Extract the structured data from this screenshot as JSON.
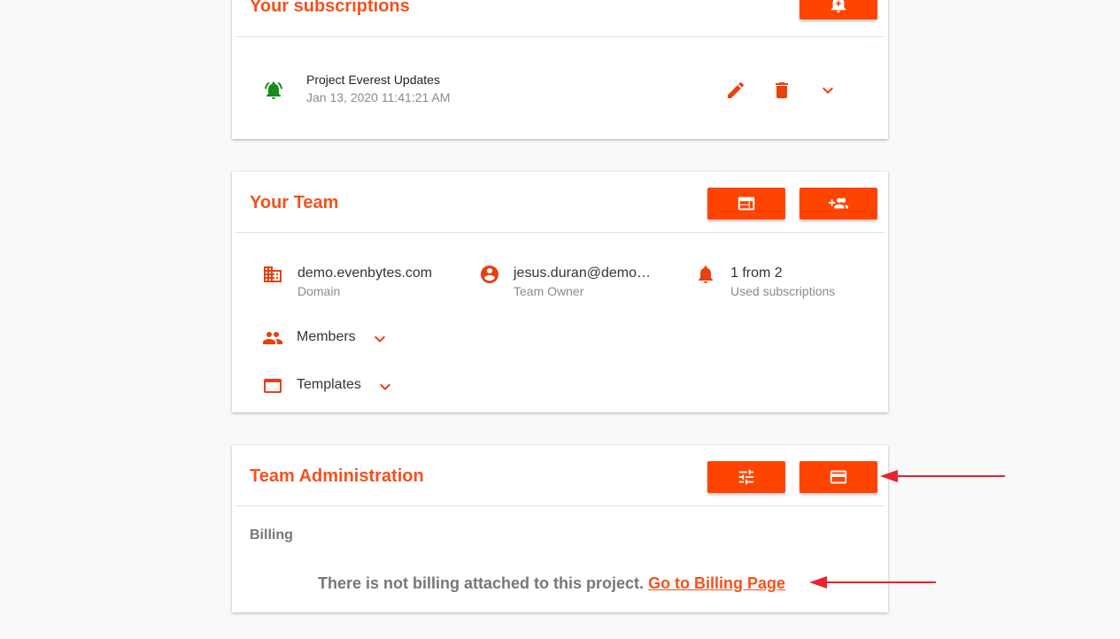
{
  "colors": {
    "accent": "#ff4400",
    "title": "#f4511e",
    "bell_active": "#1b8a1b",
    "annotation_arrow": "#e8232a"
  },
  "subscriptions": {
    "title": "Your subscriptions",
    "add_button_icon": "add-alert-icon",
    "item": {
      "name": "Project Everest Updates",
      "date": "Jan 13, 2020 11:41:21 AM",
      "icons": [
        "bell-ringing-icon",
        "edit-icon",
        "delete-icon",
        "chevron-down-icon"
      ]
    }
  },
  "team": {
    "title": "Your Team",
    "buttons": [
      "web-template-icon",
      "add-group-icon"
    ],
    "domain": {
      "value": "demo.evenbytes.com",
      "label": "Domain"
    },
    "owner": {
      "value": "jesus.duran@demo…",
      "label": "Team Owner"
    },
    "subscriptions": {
      "value": "1 from 2",
      "label": "Used subscriptions"
    },
    "members_label": "Members",
    "templates_label": "Templates"
  },
  "admin": {
    "title": "Team Administration",
    "buttons": [
      "tune-icon",
      "credit-card-icon"
    ],
    "billing_heading": "Billing",
    "billing_message": "There is not billing attached to this project.",
    "billing_link": "Go to Billing Page"
  }
}
